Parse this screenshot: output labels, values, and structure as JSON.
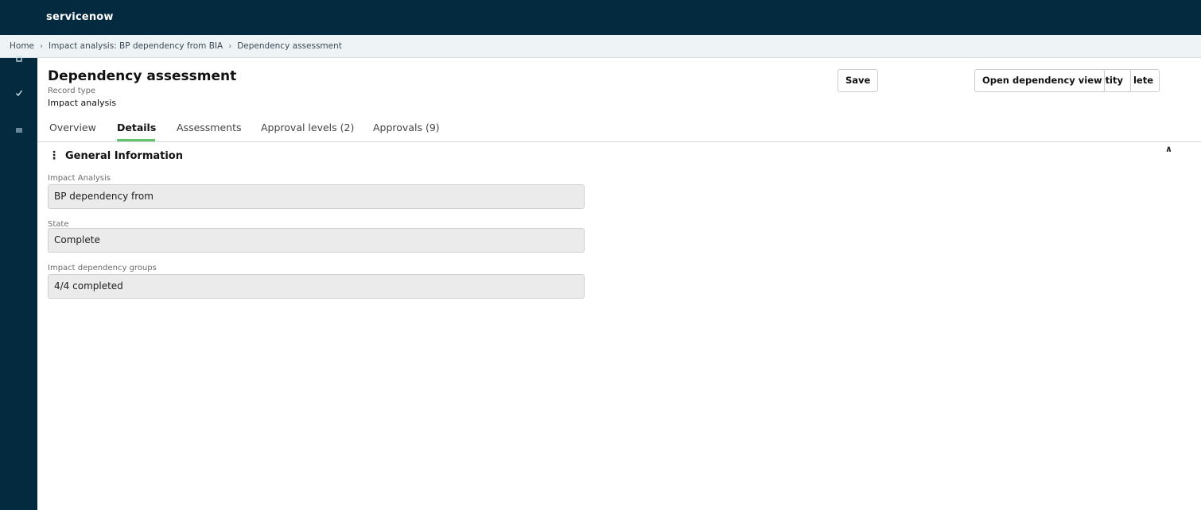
{
  "app": {
    "logo": "servicenow"
  },
  "breadcrumb": {
    "items": [
      "Home",
      "Impact analysis: BP dependency from BIA",
      "Dependency assessment"
    ],
    "separator": "›"
  },
  "rail": {
    "icons": [
      "square-icon",
      "check-icon",
      "list-icon"
    ]
  },
  "record": {
    "title": "Dependency assessment",
    "record_type_label": "Record type",
    "record_type_value": "Impact analysis"
  },
  "actions": {
    "save": "Save",
    "open_dependency_view": "Open dependency view",
    "entity_partial": "tity",
    "delete_partial": "lete"
  },
  "tabs": [
    {
      "label": "Overview",
      "active": false
    },
    {
      "label": "Details",
      "active": true
    },
    {
      "label": "Assessments",
      "active": false
    },
    {
      "label": "Approval levels (2)",
      "active": false
    },
    {
      "label": "Approvals (9)",
      "active": false
    }
  ],
  "section": {
    "title": "General Information",
    "menu_glyph": "⋮",
    "collapse_glyph": "∧",
    "fields": [
      {
        "label": "Impact Analysis",
        "value": "BP dependency from"
      },
      {
        "label": "State",
        "value": "Complete"
      },
      {
        "label": "Impact dependency groups",
        "value": "4/4 completed"
      }
    ]
  },
  "colors": {
    "header_bg": "#032a3e",
    "tab_accent": "#62c36b",
    "field_bg": "#eaebea"
  }
}
